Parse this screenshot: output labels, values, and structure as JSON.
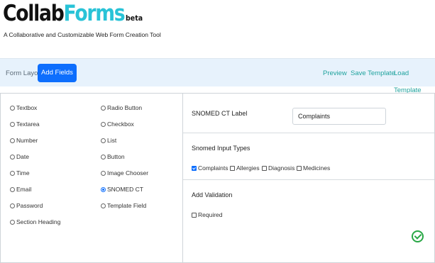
{
  "header": {
    "logo_part1": "Collab",
    "logo_part2": "Forms",
    "logo_beta": "beta",
    "tagline": "A Collaborative and Customizable Web Form Creation Tool"
  },
  "nav": {
    "form_layout": "Form Layout",
    "add_fields": "Add Fields",
    "preview": "Preview",
    "save_template": "Save Template",
    "load_template": "Load Template"
  },
  "field_types": {
    "col1": [
      "Textbox",
      "Textarea",
      "Number",
      "Date",
      "Time",
      "Email",
      "Password",
      "Section Heading"
    ],
    "col2": [
      "Radio Button",
      "Checkbox",
      "List",
      "Button",
      "Image Chooser",
      "SNOMED CT",
      "Template Field"
    ],
    "selected": "SNOMED CT"
  },
  "properties": {
    "label_caption": "SNOMED CT Label",
    "label_value": "Complaints",
    "input_types_title": "Snomed Input Types",
    "input_types": [
      {
        "label": "Complaints",
        "checked": true
      },
      {
        "label": "Allergies",
        "checked": false
      },
      {
        "label": "Diagnosis",
        "checked": false
      },
      {
        "label": "Medicines",
        "checked": false
      }
    ],
    "validation_title": "Add Validation",
    "required_label": "Required",
    "required_checked": false
  },
  "colors": {
    "accent": "#0d6efd",
    "logo_light": "#29c3d7",
    "nav_link": "#20a39e",
    "nav_bg": "#e7f2fc",
    "success": "#28a745"
  },
  "icons": {
    "confirm": "check-circle-icon"
  }
}
